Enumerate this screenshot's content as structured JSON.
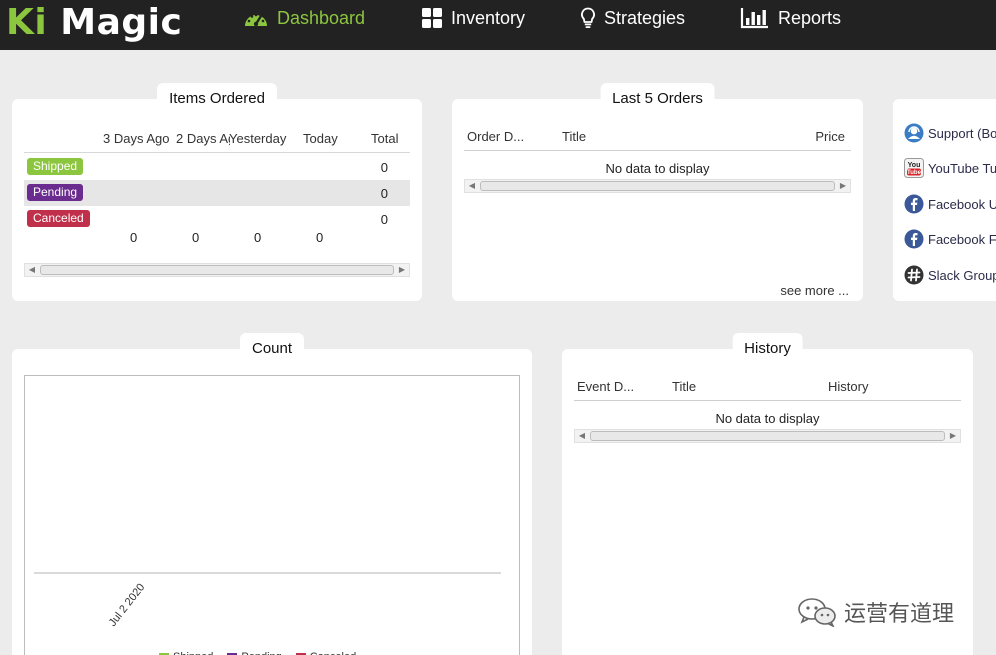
{
  "app": {
    "logo_ki": "Ki",
    "logo_magic": "Magic",
    "brand_color": "#8cc63f"
  },
  "nav": [
    {
      "label": "Dashboard",
      "icon": "gauge-icon",
      "active": true
    },
    {
      "label": "Inventory",
      "icon": "grid-icon",
      "active": false
    },
    {
      "label": "Strategies",
      "icon": "lightbulb-icon",
      "active": false
    },
    {
      "label": "Reports",
      "icon": "bar-chart-icon",
      "active": false
    }
  ],
  "items_ordered": {
    "title": "Items Ordered",
    "columns": [
      "3 Days Ago",
      "2 Days Ago",
      "Yesterday",
      "Today",
      "Total"
    ],
    "rows": [
      {
        "status": "Shipped",
        "color": "#8cc63f",
        "total": "0"
      },
      {
        "status": "Pending",
        "color": "#6a2c8e",
        "total": "0"
      },
      {
        "status": "Canceled",
        "color": "#c0304a",
        "total": "0"
      }
    ],
    "column_totals": [
      "0",
      "0",
      "0",
      "0"
    ]
  },
  "last_orders": {
    "title": "Last 5 Orders",
    "columns": [
      "Order D...",
      "Title",
      "Price"
    ],
    "empty_text": "No data to display",
    "see_more": "see more ..."
  },
  "links": [
    {
      "label": "Support (Bo",
      "icon": "support-icon"
    },
    {
      "label": "YouTube Tu",
      "icon": "youtube-icon"
    },
    {
      "label": "Facebook U",
      "icon": "facebook-icon"
    },
    {
      "label": "Facebook F",
      "icon": "facebook-icon"
    },
    {
      "label": "Slack Group",
      "icon": "slack-icon"
    }
  ],
  "count": {
    "title": "Count"
  },
  "chart_data": {
    "type": "bar",
    "categories": [
      "Jul 2 2020"
    ],
    "series": [
      {
        "name": "Shipped",
        "color": "#8cc63f",
        "values": [
          0
        ]
      },
      {
        "name": "Pending",
        "color": "#6a2c8e",
        "values": [
          0
        ]
      },
      {
        "name": "Canceled",
        "color": "#c0304a",
        "values": [
          0
        ]
      }
    ],
    "title": "Count",
    "xlabel": "",
    "ylabel": "",
    "legend": "bottom",
    "grid": false
  },
  "history": {
    "title": "History",
    "columns": [
      "Event D...",
      "Title",
      "History"
    ],
    "empty_text": "No data to display"
  },
  "watermark": {
    "text": "运营有道理",
    "icon": "wechat-icon"
  }
}
